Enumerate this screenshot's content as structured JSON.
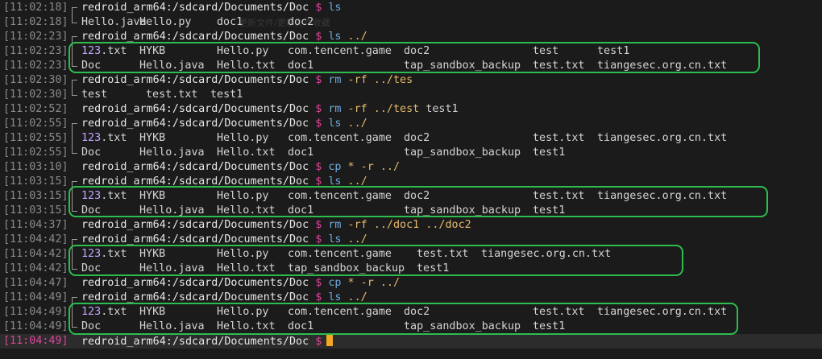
{
  "terminal": {
    "prompt_host": "redroid_arm64:/sdcard/Documents/Doc",
    "prompt_symbol": "$",
    "lines": [
      {
        "ts": "[11:02:18]",
        "kind": "prompt",
        "cmd": "ls",
        "args": ""
      },
      {
        "ts": "[11:02:18]",
        "kind": "output",
        "cols": [
          "Hello.java",
          "Hello.py",
          "doc1",
          "doc2"
        ]
      },
      {
        "ts": "[11:02:23]",
        "kind": "prompt",
        "cmd": "ls",
        "args": "../"
      },
      {
        "ts": "[11:02:23]",
        "kind": "output",
        "cols": [
          "123.txt",
          "HYKB",
          "Hello.py",
          "com.tencent.game",
          "doc2",
          "test",
          "test1"
        ]
      },
      {
        "ts": "[11:02:23]",
        "kind": "output",
        "cols": [
          "Doc",
          "Hello.java",
          "Hello.txt",
          "doc1",
          "tap_sandbox_backup",
          "test.txt",
          "tiangesec.org.cn.txt"
        ]
      },
      {
        "ts": "[11:02:30]",
        "kind": "prompt",
        "cmd": "rm",
        "args": "-rf ../tes"
      },
      {
        "ts": "[11:02:30]",
        "kind": "output",
        "cols": [
          "test",
          "test.txt",
          "test1"
        ]
      },
      {
        "ts": "[11:02:52]",
        "kind": "prompt",
        "cmd": "rm",
        "args": "-rf ../test test1"
      },
      {
        "ts": "[11:02:55]",
        "kind": "prompt",
        "cmd": "ls",
        "args": "../"
      },
      {
        "ts": "[11:02:55]",
        "kind": "output",
        "cols": [
          "123.txt",
          "HYKB",
          "Hello.py",
          "com.tencent.game",
          "doc2",
          "test.txt",
          "tiangesec.org.cn.txt"
        ]
      },
      {
        "ts": "[11:02:55]",
        "kind": "output",
        "cols": [
          "Doc",
          "Hello.java",
          "Hello.txt",
          "doc1",
          "tap_sandbox_backup",
          "test1"
        ]
      },
      {
        "ts": "[11:03:10]",
        "kind": "prompt",
        "cmd": "cp",
        "args": "* -r ../"
      },
      {
        "ts": "[11:03:15]",
        "kind": "prompt",
        "cmd": "ls",
        "args": "../"
      },
      {
        "ts": "[11:03:15]",
        "kind": "output",
        "cols": [
          "123.txt",
          "HYKB",
          "Hello.py",
          "com.tencent.game",
          "doc2",
          "test.txt",
          "tiangesec.org.cn.txt"
        ]
      },
      {
        "ts": "[11:03:15]",
        "kind": "output",
        "cols": [
          "Doc",
          "Hello.java",
          "Hello.txt",
          "doc1",
          "tap_sandbox_backup",
          "test1"
        ]
      },
      {
        "ts": "[11:04:37]",
        "kind": "prompt",
        "cmd": "rm",
        "args": "-rf ../doc1 ../doc2"
      },
      {
        "ts": "[11:04:42]",
        "kind": "prompt",
        "cmd": "ls",
        "args": "../"
      },
      {
        "ts": "[11:04:42]",
        "kind": "output",
        "cols": [
          "123.txt",
          "HYKB",
          "Hello.py",
          "com.tencent.game",
          "test.txt",
          "tiangesec.org.cn.txt"
        ]
      },
      {
        "ts": "[11:04:42]",
        "kind": "output",
        "cols": [
          "Doc",
          "Hello.java",
          "Hello.txt",
          "tap_sandbox_backup",
          "test1"
        ]
      },
      {
        "ts": "[11:04:47]",
        "kind": "prompt",
        "cmd": "cp",
        "args": "* -r ../"
      },
      {
        "ts": "[11:04:49]",
        "kind": "prompt",
        "cmd": "ls",
        "args": "../"
      },
      {
        "ts": "[11:04:49]",
        "kind": "output",
        "cols": [
          "123.txt",
          "HYKB",
          "Hello.py",
          "com.tencent.game",
          "doc2",
          "test.txt",
          "tiangesec.org.cn.txt"
        ]
      },
      {
        "ts": "[11:04:49]",
        "kind": "output",
        "cols": [
          "Doc",
          "Hello.java",
          "Hello.txt",
          "doc1",
          "tap_sandbox_backup",
          "test1"
        ]
      },
      {
        "ts": "[11:04:49]",
        "kind": "prompt",
        "cmd": "",
        "args": "",
        "current": true
      }
    ]
  },
  "colors": {
    "highlight_box": "#2dbd4f",
    "timestamp": "#8a8a8a",
    "timestamp_current": "#e0449a",
    "dollar": "#e0449a",
    "command": "#6fa8dc",
    "argument": "#e7b96d",
    "dir_entry": "#c3a6ff",
    "cursor": "#f5a623"
  },
  "ghost_text": "更新文件/更新文件收藏"
}
